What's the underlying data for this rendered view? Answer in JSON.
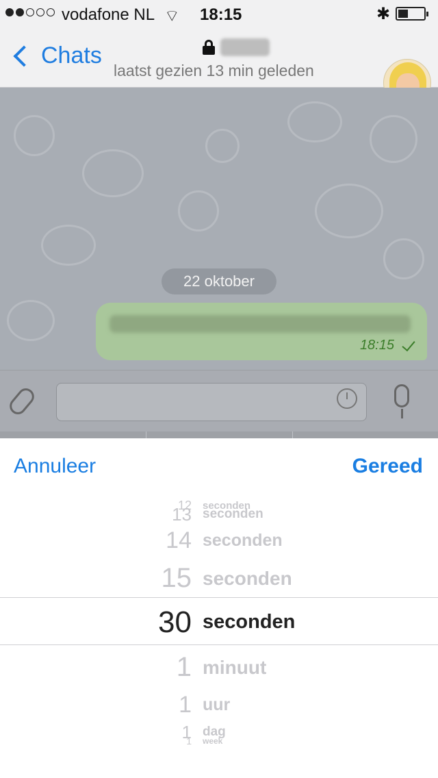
{
  "status_bar": {
    "carrier": "vodafone NL",
    "time": "18:15"
  },
  "nav": {
    "back_label": "Chats",
    "subtitle": "laatst gezien 13 min geleden"
  },
  "chat": {
    "date": "22 oktober",
    "message_time": "18:15"
  },
  "picker": {
    "cancel_label": "Annuleer",
    "done_label": "Gereed",
    "rows": [
      {
        "num": "12",
        "unit": "seconden"
      },
      {
        "num": "13",
        "unit": "seconden"
      },
      {
        "num": "14",
        "unit": "seconden"
      },
      {
        "num": "15",
        "unit": "seconden"
      },
      {
        "num": "30",
        "unit": "seconden"
      },
      {
        "num": "1",
        "unit": "minuut"
      },
      {
        "num": "1",
        "unit": "uur"
      },
      {
        "num": "1",
        "unit": "dag"
      },
      {
        "num": "1",
        "unit": "week"
      }
    ],
    "selected_index": 4
  }
}
